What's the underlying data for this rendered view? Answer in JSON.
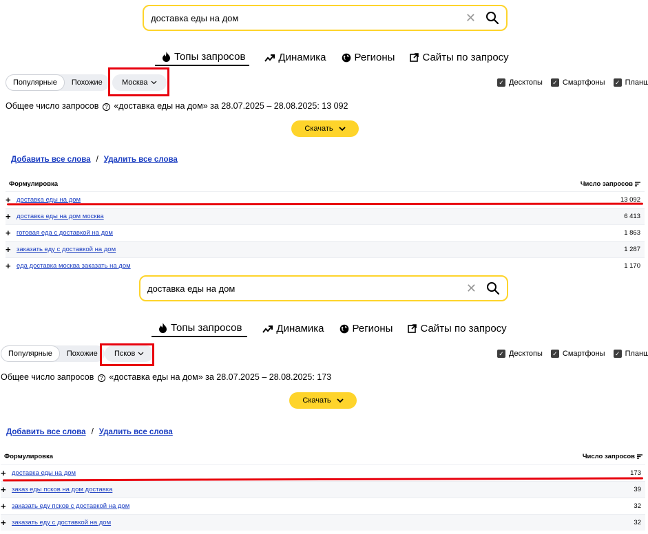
{
  "panels": [
    {
      "query": "доставка еды на дом",
      "tabs": [
        "Топы запросов",
        "Динамика",
        "Регионы",
        "Сайты по запросу"
      ],
      "segment": [
        "Популярные",
        "Похожие"
      ],
      "region": "Москва",
      "devices": [
        "Десктопы",
        "Смартфоны",
        "Планшеты"
      ],
      "total": "Общее число запросов",
      "total_rest": "«доставка еды на дом» за 28.07.2025 – 28.08.2025: 13 092",
      "download": "Скачать",
      "add_all": "Добавить все слова",
      "remove_all": "Удалить все слова",
      "col_phrase": "Формулировка",
      "col_count": "Число запросов",
      "rows": [
        {
          "phrase": "доставка еды на дом",
          "count": "13 092"
        },
        {
          "phrase": "доставка еды на дом москва",
          "count": "6 413"
        },
        {
          "phrase": "готовая еда с доставкой на дом",
          "count": "1 863"
        },
        {
          "phrase": "заказать еду с доставкой на дом",
          "count": "1 287"
        },
        {
          "phrase": "еда доставка москва заказать на дом",
          "count": "1 170"
        }
      ]
    },
    {
      "query": "доставка еды на дом",
      "tabs": [
        "Топы запросов",
        "Динамика",
        "Регионы",
        "Сайты по запросу"
      ],
      "segment": [
        "Популярные",
        "Похожие"
      ],
      "region": "Псков",
      "devices": [
        "Десктопы",
        "Смартфоны",
        "Планшеты"
      ],
      "total": "Общее число запросов",
      "total_rest": "«доставка еды на дом» за 28.07.2025 – 28.08.2025: 173",
      "download": "Скачать",
      "add_all": "Добавить все слова",
      "remove_all": "Удалить все слова",
      "col_phrase": "Формулировка",
      "col_count": "Число запросов",
      "rows": [
        {
          "phrase": "доставка еды на дом",
          "count": "173"
        },
        {
          "phrase": "заказ еды псков на дом доставка",
          "count": "39"
        },
        {
          "phrase": "заказать еду псков с доставкой на дом",
          "count": "32"
        },
        {
          "phrase": "заказать еду с доставкой на дом",
          "count": "32"
        }
      ]
    }
  ],
  "icons": {
    "tabs": [
      "fire-icon",
      "trend-icon",
      "globe-icon",
      "external-link-icon"
    ],
    "search": "search-icon",
    "clear": "clear-icon",
    "download_chevron": "chevron-down-icon"
  },
  "colors": {
    "accent": "#fed42b",
    "link": "#1a3dc1",
    "highlight": "#e8000d"
  }
}
